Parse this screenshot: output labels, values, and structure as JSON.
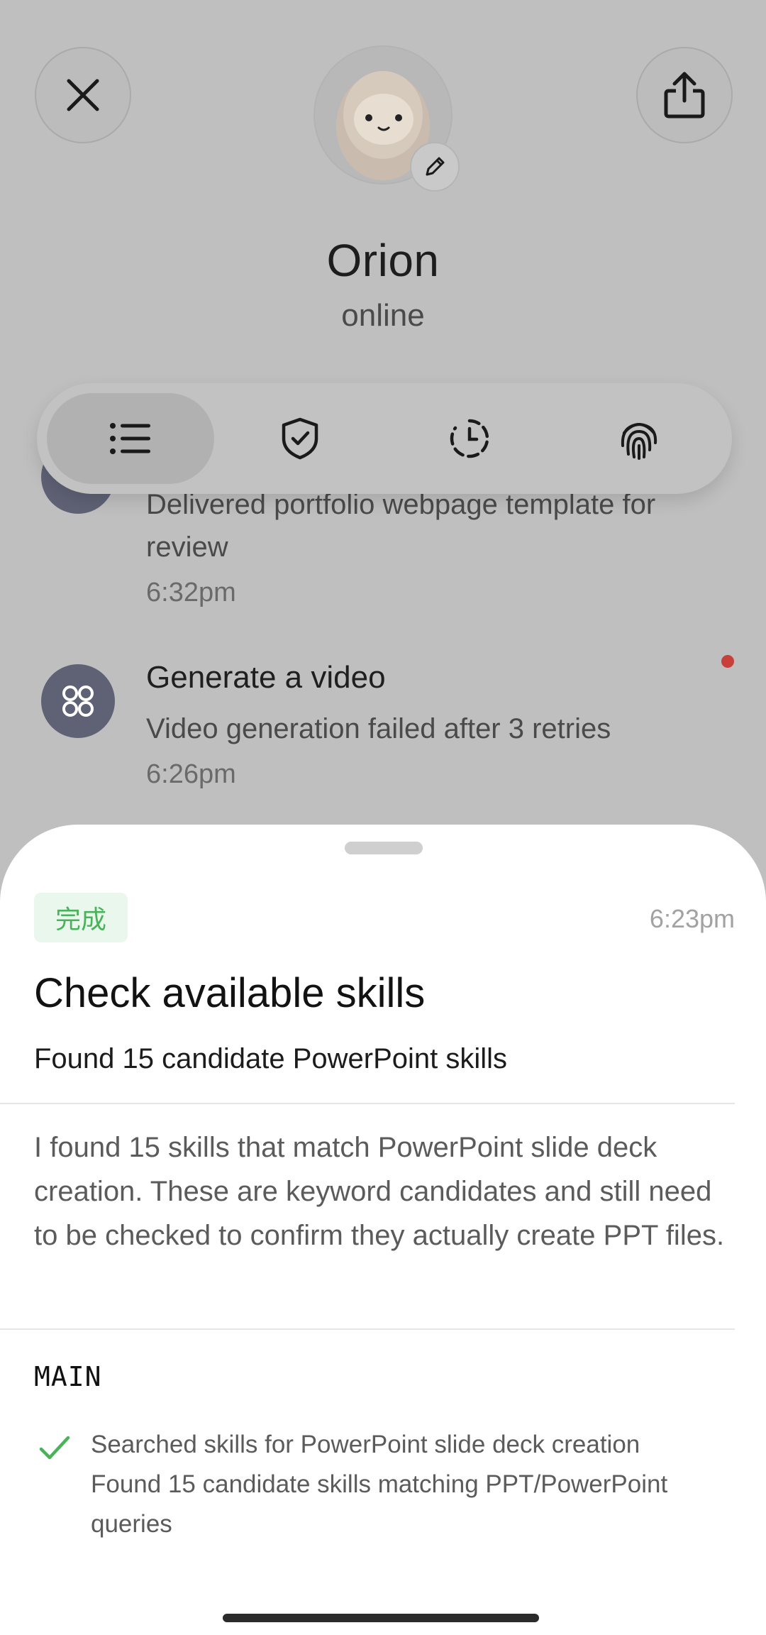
{
  "header": {
    "name": "Orion",
    "status": "online"
  },
  "toolbar": {
    "items": [
      {
        "icon": "list-icon",
        "active": true
      },
      {
        "icon": "shield-check-icon",
        "active": false
      },
      {
        "icon": "clock-dashed-icon",
        "active": false
      },
      {
        "icon": "fingerprint-icon",
        "active": false
      }
    ]
  },
  "feed": [
    {
      "title": "",
      "text_line1": "Delivered portfolio webpage template for",
      "text_line2": "review",
      "time": "6:32pm"
    },
    {
      "title": "Generate a video",
      "text": "Video generation failed after 3 retries",
      "time": "6:26pm",
      "unread": true
    }
  ],
  "sheet": {
    "status": "完成",
    "time": "6:23pm",
    "title": "Check available skills",
    "summary": "Found 15 candidate PowerPoint skills",
    "description": "I found 15 skills that match PowerPoint slide deck creation. These are keyword candidates and still need to be checked to confirm they actually create PPT files.",
    "section": "MAIN",
    "steps": [
      {
        "line1": "Searched skills for PowerPoint slide deck creation",
        "line2": "Found 15 candidate skills matching PPT/PowerPoint queries",
        "done": true
      }
    ]
  },
  "colors": {
    "accent_green": "#49b35a",
    "badge_bg": "#e9f7ec",
    "unread_dot": "#c8403a",
    "feed_avatar": "#5f6275"
  }
}
